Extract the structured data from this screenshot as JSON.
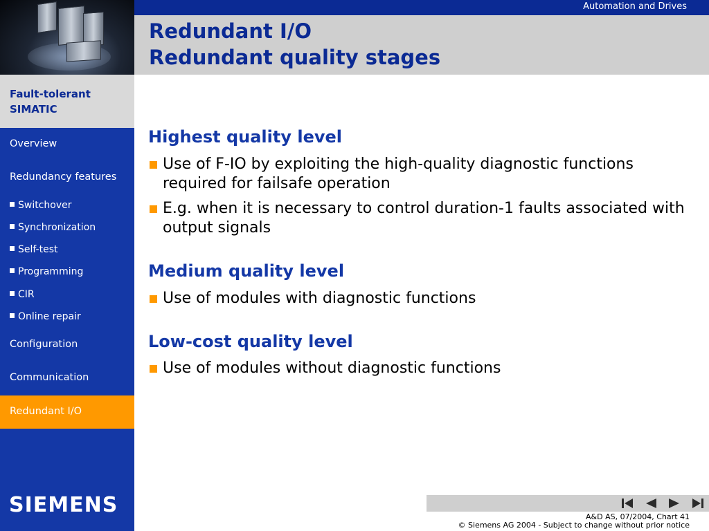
{
  "header": {
    "brand_text": "Automation and Drives",
    "title_line1": "Redundant I/O",
    "title_line2": "Redundant quality stages",
    "photo_label": "simatic-hardware-photo"
  },
  "sidebar": {
    "section_line1": "Fault-tolerant",
    "section_line2": "SIMATIC",
    "items": [
      {
        "label": "Overview",
        "sub": false
      },
      {
        "label": "Redundancy features",
        "sub": false
      },
      {
        "label": "Switchover",
        "sub": true
      },
      {
        "label": "Synchronization",
        "sub": true
      },
      {
        "label": "Self-test",
        "sub": true
      },
      {
        "label": "Programming",
        "sub": true
      },
      {
        "label": "CIR",
        "sub": true
      },
      {
        "label": "Online repair",
        "sub": true
      },
      {
        "label": "Configuration",
        "sub": false
      },
      {
        "label": "Communication",
        "sub": false
      }
    ],
    "active_item": "Redundant I/O",
    "logo": "SIEMENS"
  },
  "content": {
    "sections": [
      {
        "heading": "Highest quality level",
        "bullets": [
          "Use of F-IO by exploiting the high-quality diagnostic functions required for failsafe operation",
          "E.g. when it is necessary to control duration-1 faults associated with output signals"
        ]
      },
      {
        "heading": "Medium quality level",
        "bullets": [
          "Use of modules with diagnostic functions"
        ]
      },
      {
        "heading": "Low-cost quality level",
        "bullets": [
          "Use of modules without diagnostic functions"
        ]
      }
    ]
  },
  "footer": {
    "line1": "A&D AS, 07/2004, Chart 41",
    "line2": "© Siemens AG 2004  - Subject to change without prior notice"
  },
  "colors": {
    "brand_blue": "#0b2a94",
    "sidebar_blue": "#1438a6",
    "accent_orange": "#ff9900",
    "title_gray": "#cfcfcf"
  },
  "icons": {
    "nav_first": "skip-to-first-icon",
    "nav_prev": "previous-icon",
    "nav_next": "next-icon",
    "nav_last": "skip-to-last-icon"
  }
}
